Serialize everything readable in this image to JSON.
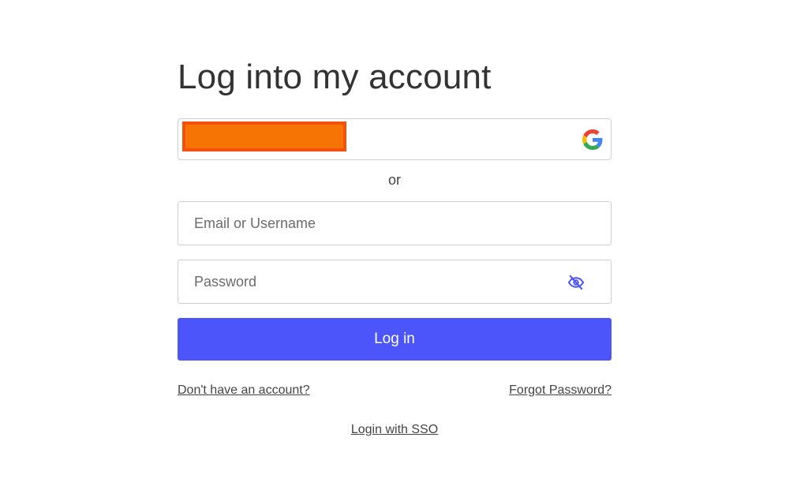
{
  "page": {
    "title": "Log into my account"
  },
  "google_button": {
    "icon": "google-icon",
    "redaction_color": "#f67404"
  },
  "divider": {
    "text": "or"
  },
  "email_field": {
    "placeholder": "Email or Username",
    "value": ""
  },
  "password_field": {
    "placeholder": "Password",
    "value": "",
    "toggle_icon": "eye-slash-icon"
  },
  "login_button": {
    "label": "Log in",
    "color": "#4c55fa"
  },
  "links": {
    "signup": "Don't have an account?",
    "forgot": "Forgot Password?",
    "sso": "Login with SSO"
  }
}
